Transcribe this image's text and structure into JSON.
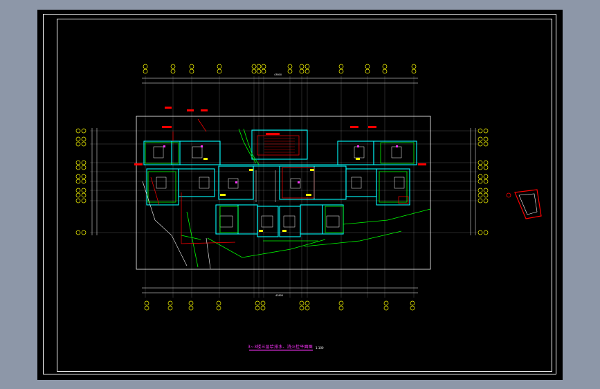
{
  "sheet": {
    "caption": "3~3楼三层给排水、消火栓平面图",
    "scale": "1:100",
    "overall_dim_top": "43800",
    "overall_dim_bottom": "43800"
  },
  "colors": {
    "background": "#000000",
    "frame": "#ffffff",
    "grid_bubble": "#ffff00",
    "walls_cyan": "#00ffff",
    "pipes_green": "#00ff00",
    "red_lines": "#ff0000",
    "magenta": "#ff33ff",
    "dim_lines": "#ffffff"
  }
}
